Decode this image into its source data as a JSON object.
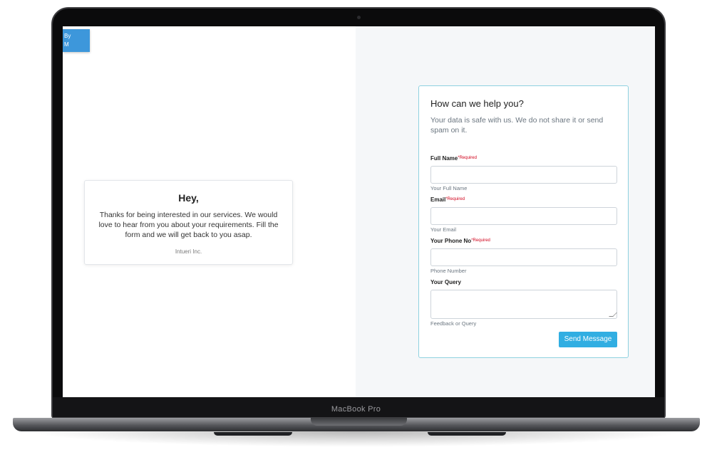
{
  "device": {
    "model_label": "MacBook Pro"
  },
  "corner_badge": {
    "line1": "By",
    "line2": "M"
  },
  "intro_card": {
    "title": "Hey,",
    "body": "Thanks for being interested in our services. We would love to hear from you about your requirements. Fill the form and we will get back to you asap.",
    "signature": "Intueri Inc."
  },
  "contact_form": {
    "title": "How can we help you?",
    "subtitle": "Your data is safe with us. We do not share it or send spam on it.",
    "required_marker": "*Required",
    "fields": [
      {
        "label": "Full Name",
        "required": true,
        "value": "",
        "help": "Your Full Name"
      },
      {
        "label": "Email",
        "required": true,
        "value": "",
        "help": "Your Email"
      },
      {
        "label": "Your Phone No",
        "required": true,
        "value": "",
        "help": "Phone Number"
      },
      {
        "label": "Your Query",
        "required": false,
        "value": "",
        "help": "Feedback or Query"
      }
    ],
    "submit_label": "Send Message"
  },
  "colors": {
    "badge": "#3d97db",
    "submit_button": "#31aee2",
    "form_border": "#8fd1e0",
    "required_text": "#d0021b",
    "right_pane_bg": "#f5f7f9"
  }
}
